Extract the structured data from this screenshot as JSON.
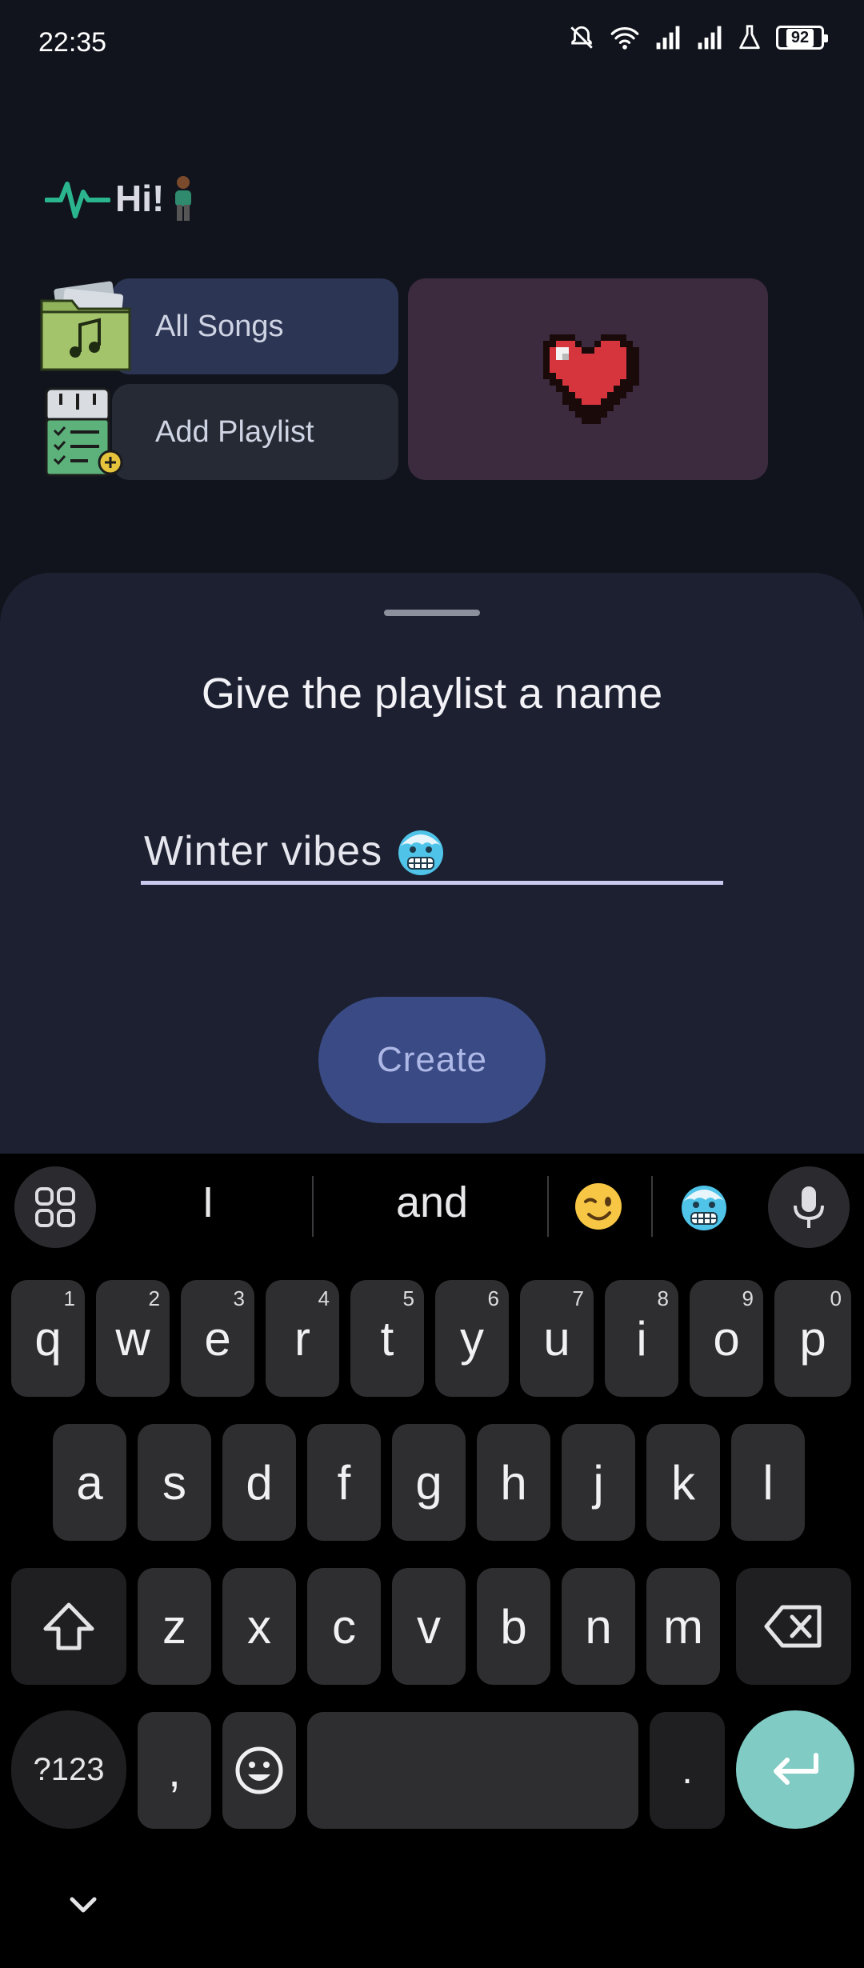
{
  "status_bar": {
    "time": "22:35",
    "battery": "92",
    "icons": [
      "mute-bell-icon",
      "wifi-icon",
      "signal-icon",
      "signal-icon",
      "lab-flask-icon",
      "battery-icon"
    ]
  },
  "header": {
    "greeting": "Hi!",
    "logo_icon": "pulse-wave-icon",
    "avatar_icon": "person-emoji-icon"
  },
  "cards": {
    "all_songs": {
      "label": "All Songs",
      "icon": "music-folder-icon"
    },
    "add_playlist": {
      "label": "Add Playlist",
      "icon": "playlist-add-icon"
    },
    "favorites": {
      "icon": "pixel-heart-icon"
    }
  },
  "sheet": {
    "title": "Give the playlist a name",
    "input_value": "Winter vibes",
    "input_emoji_icon": "cold-face-emoji",
    "create_label": "Create"
  },
  "keyboard": {
    "suggestions": [
      "I",
      "and"
    ],
    "suggestion_emojis": [
      "winking-face-emoji",
      "cold-face-emoji"
    ],
    "row1": [
      "q",
      "w",
      "e",
      "r",
      "t",
      "y",
      "u",
      "i",
      "o",
      "p"
    ],
    "row1_hints": [
      "1",
      "2",
      "3",
      "4",
      "5",
      "6",
      "7",
      "8",
      "9",
      "0"
    ],
    "row2": [
      "a",
      "s",
      "d",
      "f",
      "g",
      "h",
      "j",
      "k",
      "l"
    ],
    "row3": [
      "z",
      "x",
      "c",
      "v",
      "b",
      "n",
      "m"
    ],
    "symbols_label": "?123",
    "comma": ",",
    "period": ".",
    "accent_color": "#80cbc4"
  }
}
